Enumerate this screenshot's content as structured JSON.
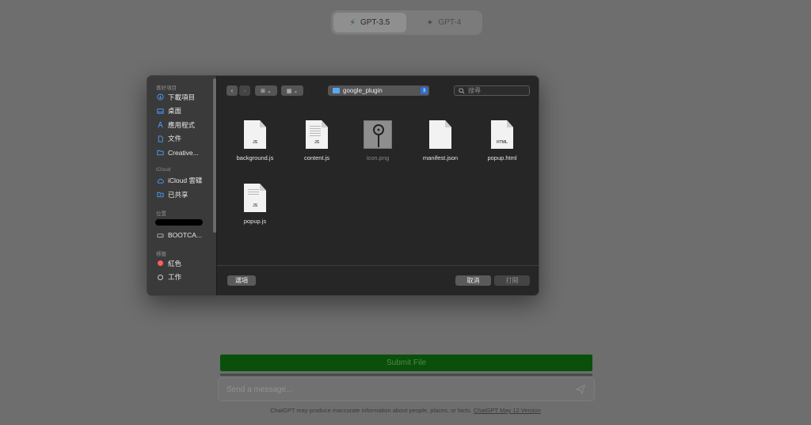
{
  "models": {
    "gpt35": {
      "label": "GPT-3.5",
      "icon": "lightning-icon"
    },
    "gpt4": {
      "label": "GPT-4",
      "icon": "sparkle-icon"
    }
  },
  "composer": {
    "submit_label": "Submit File",
    "placeholder": "Send a message..."
  },
  "footer": {
    "text": "ChatGPT may produce inaccurate information about people, places, or facts. ",
    "link": "ChatGPT May 12 Version"
  },
  "dialog": {
    "sidebar": {
      "favorites_header": "喜好項目",
      "favorites": [
        {
          "label": "下載項目",
          "icon": "download-icon"
        },
        {
          "label": "桌面",
          "icon": "desktop-icon"
        },
        {
          "label": "應用程式",
          "icon": "apps-icon"
        },
        {
          "label": "文件",
          "icon": "document-icon"
        },
        {
          "label": "Creative...",
          "icon": "folder-icon"
        }
      ],
      "icloud_header": "iCloud",
      "icloud": [
        {
          "label": "iCloud 雲碟",
          "icon": "cloud-icon"
        },
        {
          "label": "已共享",
          "icon": "shared-folder-icon"
        }
      ],
      "locations_header": "位置",
      "locations": [
        {
          "label": "BOOTCA...",
          "icon": "drive-icon"
        }
      ],
      "tags_header": "標籤",
      "tags": [
        {
          "label": "紅色",
          "color": "#ff5f57"
        },
        {
          "label": "工作",
          "color": ""
        }
      ]
    },
    "path": "google_plugin",
    "search_placeholder": "搜尋",
    "files": [
      {
        "name": "background.js",
        "ext": "JS",
        "dim": false
      },
      {
        "name": "content.js",
        "ext": "JS",
        "dim": false
      },
      {
        "name": "icon.png",
        "ext": "",
        "dim": true
      },
      {
        "name": "manifest.json",
        "ext": "",
        "dim": false
      },
      {
        "name": "popup.html",
        "ext": "HTML",
        "dim": false
      },
      {
        "name": "popup.js",
        "ext": "JS",
        "dim": false
      }
    ],
    "options_label": "選項",
    "cancel_label": "取消",
    "open_label": "打開"
  }
}
